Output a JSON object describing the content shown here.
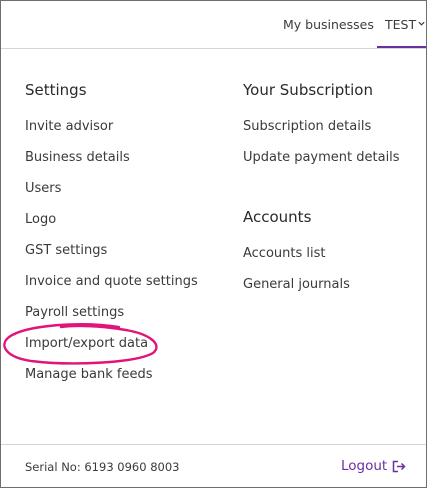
{
  "topbar": {
    "my_businesses": "My businesses",
    "account": "TEST",
    "chevron_icon": "chevron-down-icon"
  },
  "settings": {
    "heading": "Settings",
    "items": [
      "Invite advisor",
      "Business details",
      "Users",
      "Logo",
      "GST settings",
      "Invoice and quote settings",
      "Payroll settings",
      "Import/export data",
      "Manage bank feeds"
    ]
  },
  "subscription": {
    "heading": "Your Subscription",
    "items": [
      "Subscription details",
      "Update payment details"
    ]
  },
  "accounts": {
    "heading": "Accounts",
    "items": [
      "Accounts list",
      "General journals"
    ]
  },
  "footer": {
    "serial": "Serial No: 6193 0960 8003",
    "logout": "Logout",
    "logout_icon": "logout-arrow-icon"
  },
  "colors": {
    "accent": "#6b2fa2",
    "highlight_ring": "#e0147a",
    "text": "#3a3a3a",
    "divider": "#d6d6d6"
  }
}
